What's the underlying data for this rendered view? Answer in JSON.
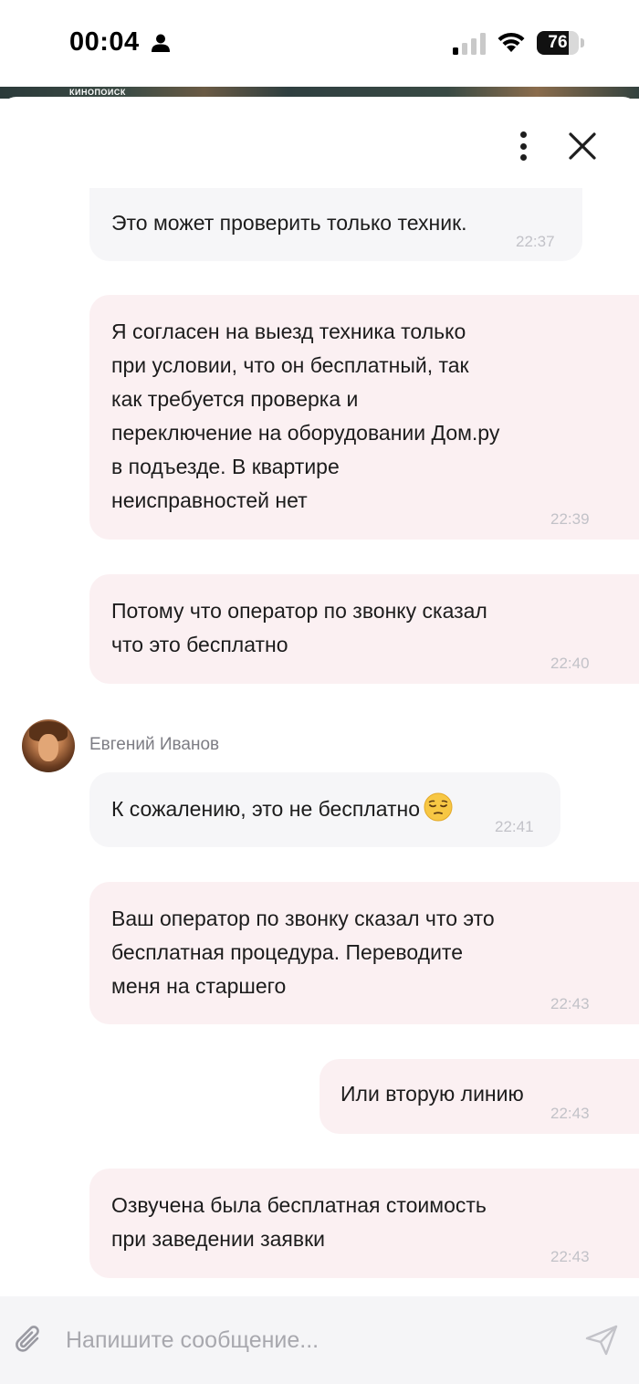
{
  "status_bar": {
    "time": "00:04",
    "battery_level": "76",
    "battery_fraction": 0.76
  },
  "banner": {
    "logo_text": "КИНОПОИСК"
  },
  "header": {
    "menu_icon": "more-vertical-icon",
    "close_icon": "close-icon"
  },
  "messages": [
    {
      "direction": "incoming",
      "text": "Это может проверить только техник.",
      "time": "22:37"
    },
    {
      "direction": "outgoing",
      "text": "Я согласен на выезд техника только\nпри условии, что он бесплатный, так\nкак требуется проверка и\nпереключение на оборудовании Дом.ру\nв подъезде. В квартире\nнеисправностей нет",
      "time": "22:39"
    },
    {
      "direction": "outgoing",
      "text": "Потому что оператор по звонку сказал\nчто это бесплатно",
      "time": "22:40"
    },
    {
      "direction": "incoming",
      "sender": "Евгений Иванов",
      "text": "К сожалению, это не бесплатно",
      "emoji": "pensive-face-emoji",
      "time": "22:41"
    },
    {
      "direction": "outgoing",
      "text": "Ваш оператор по звонку сказал что это\nбесплатная процедура. Переводите\nменя на старшего",
      "time": "22:43"
    },
    {
      "direction": "outgoing",
      "text": "Или вторую линию",
      "time": "22:43"
    },
    {
      "direction": "outgoing",
      "text": "Озвучена была бесплатная стоимость\nпри заведении заявки",
      "time": "22:43"
    }
  ],
  "composer": {
    "placeholder": "Напишите сообщение...",
    "value": "",
    "attach_icon": "paperclip-icon",
    "send_icon": "send-icon"
  },
  "colors": {
    "incoming_bubble": "#f6f6f8",
    "outgoing_bubble": "#fbf0f2",
    "timestamp": "#c2c2c8",
    "composer_bg": "#f5f5f7"
  }
}
